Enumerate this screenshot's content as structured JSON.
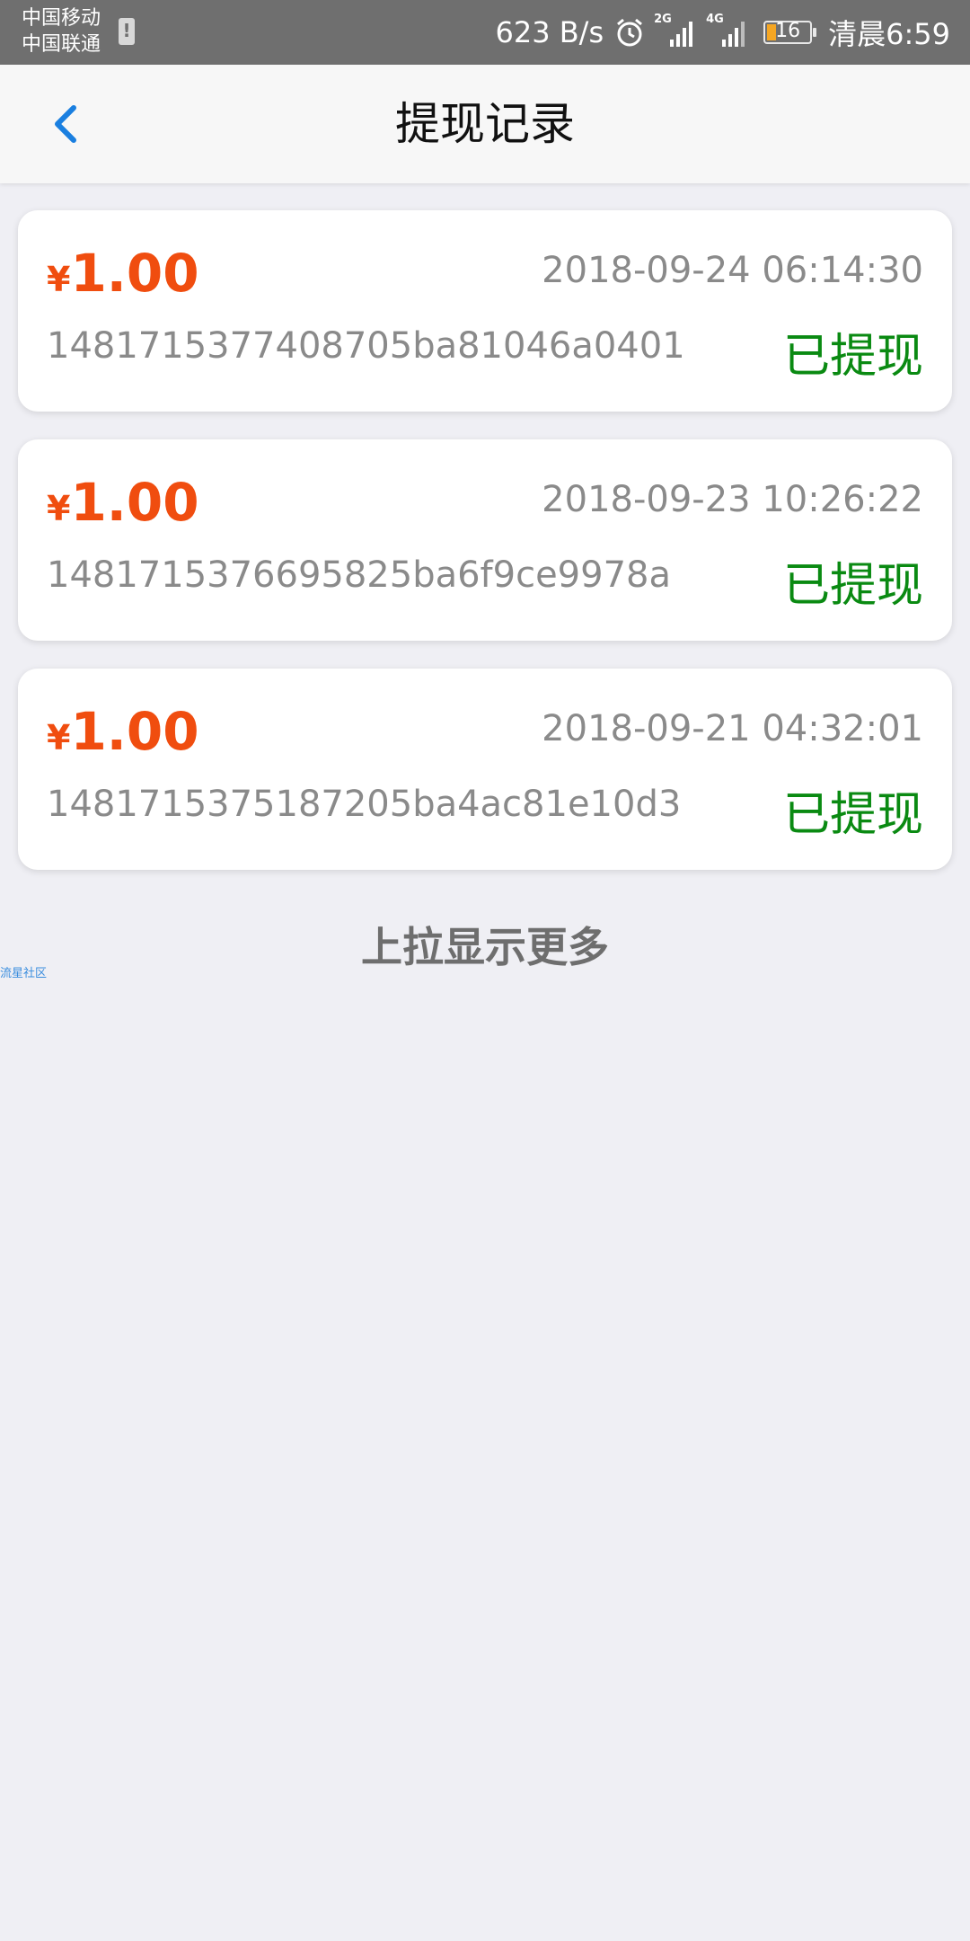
{
  "status_bar": {
    "carrier_1": "中国移动",
    "carrier_2": "中国联通",
    "net_speed": "623 B/s",
    "signal_1_tag": "2G",
    "signal_2_tag": "4G",
    "battery_level": "16",
    "time": "清晨6:59"
  },
  "header": {
    "title": "提现记录",
    "back_icon": "chevron-left-icon"
  },
  "records": [
    {
      "currency": "¥",
      "amount": "1.00",
      "time": "2018-09-24 06:14:30",
      "id": "1481715377408705ba81046a0401",
      "status": "已提现"
    },
    {
      "currency": "¥",
      "amount": "1.00",
      "time": "2018-09-23 10:26:22",
      "id": "1481715376695825ba6f9ce9978a",
      "status": "已提现"
    },
    {
      "currency": "¥",
      "amount": "1.00",
      "time": "2018-09-21 04:32:01",
      "id": "1481715375187205ba4ac81e10d3",
      "status": "已提现"
    }
  ],
  "load_more": "上拉显示更多",
  "watermark": "流星社区",
  "colors": {
    "amount": "#f04d0f",
    "status": "#0a8a12",
    "back": "#1a7fe0",
    "background": "#efeff4"
  }
}
